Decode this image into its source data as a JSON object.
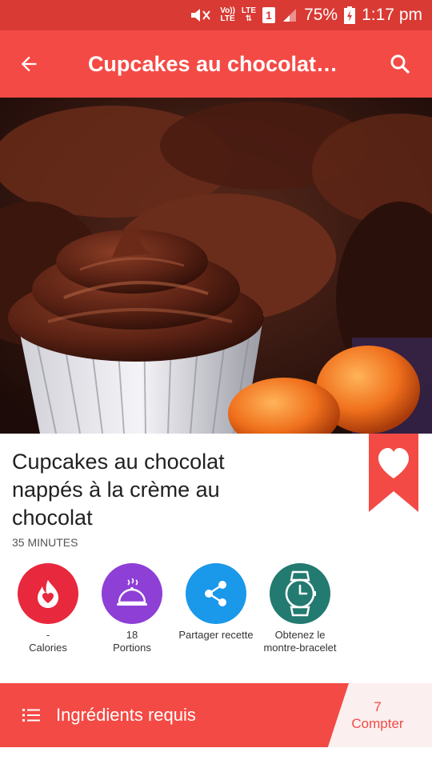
{
  "status_bar": {
    "network_label_top": "Vo))",
    "network_label_bottom": "LTE",
    "lte_label": "LTE",
    "sim_badge": "1",
    "battery_percent": "75%",
    "time": "1:17 pm"
  },
  "app_bar": {
    "title": "Cupcakes au chocolat…",
    "back_icon": "arrow-back-icon",
    "search_icon": "search-icon"
  },
  "recipe": {
    "title": "Cupcakes au chocolat nappés à la crème au chocolat",
    "time": "35 MINUTES"
  },
  "actions": [
    {
      "icon": "flame-heart-icon",
      "color": "#e8283d",
      "value": "-",
      "label": "Calories"
    },
    {
      "icon": "serving-dish-icon",
      "color": "#8e3fd6",
      "value": "18",
      "label": "Portions"
    },
    {
      "icon": "share-icon",
      "color": "#1a98ea",
      "value": "",
      "label": "Partager recette"
    },
    {
      "icon": "watch-icon",
      "color": "#237a70",
      "value": "",
      "label": "Obtenez le montre-bracelet"
    }
  ],
  "ingredients_bar": {
    "label": "Ingrédients requis",
    "count_value": "7",
    "count_label": "Compter"
  },
  "colors": {
    "status_bar": "#d93a33",
    "app_bar": "#f44a45",
    "accent": "#f44a45"
  }
}
